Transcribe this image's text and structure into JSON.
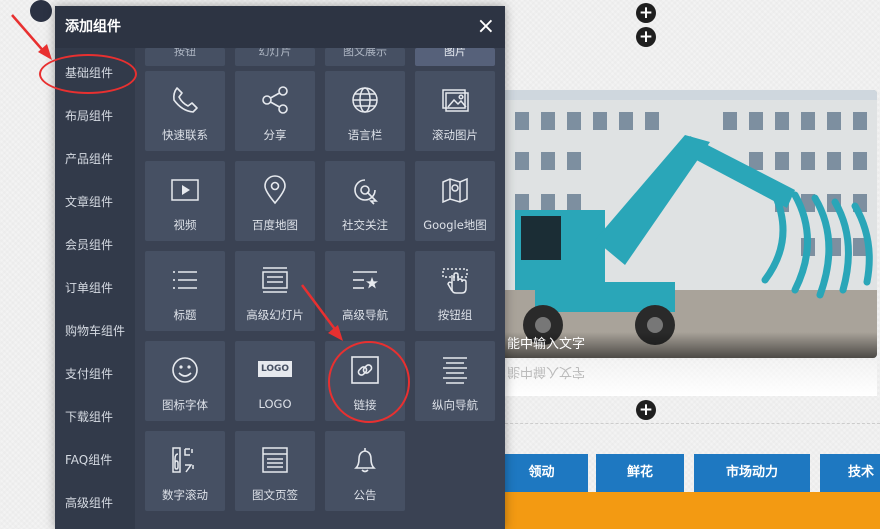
{
  "background": {
    "banner_caption": "能中输入文字",
    "reflection_text": "能中输入文字",
    "nav": [
      "领动",
      "鲜花",
      "市场动力",
      "技术"
    ]
  },
  "modal": {
    "title": "添加组件",
    "close": "×"
  },
  "sidebar": {
    "items": [
      {
        "label": "基础组件",
        "active": true
      },
      {
        "label": "布局组件"
      },
      {
        "label": "产品组件"
      },
      {
        "label": "文章组件"
      },
      {
        "label": "会员组件"
      },
      {
        "label": "订单组件"
      },
      {
        "label": "购物车组件"
      },
      {
        "label": "支付组件"
      },
      {
        "label": "下载组件"
      },
      {
        "label": "FAQ组件"
      },
      {
        "label": "高级组件"
      }
    ]
  },
  "top_row": [
    "按钮",
    "幻灯片",
    "图文展示",
    "图片"
  ],
  "tiles": [
    {
      "label": "快速联系",
      "icon": "phone-icon"
    },
    {
      "label": "分享",
      "icon": "share-icon"
    },
    {
      "label": "语言栏",
      "icon": "globe-icon"
    },
    {
      "label": "滚动图片",
      "icon": "scroll-image-icon"
    },
    {
      "label": "视频",
      "icon": "video-icon"
    },
    {
      "label": "百度地图",
      "icon": "map-pin-icon"
    },
    {
      "label": "社交关注",
      "icon": "social-follow-icon"
    },
    {
      "label": "Google地图",
      "icon": "google-map-icon"
    },
    {
      "label": "标题",
      "icon": "heading-icon"
    },
    {
      "label": "高级幻灯片",
      "icon": "advanced-slider-icon"
    },
    {
      "label": "高级导航",
      "icon": "advanced-nav-icon"
    },
    {
      "label": "按钮组",
      "icon": "button-group-icon"
    },
    {
      "label": "图标字体",
      "icon": "smiley-icon"
    },
    {
      "label": "LOGO",
      "icon": "logo-icon"
    },
    {
      "label": "链接",
      "icon": "link-icon"
    },
    {
      "label": "纵向导航",
      "icon": "vertical-nav-icon"
    },
    {
      "label": "数字滚动",
      "icon": "number-scroll-icon"
    },
    {
      "label": "图文页签",
      "icon": "image-text-tab-icon"
    },
    {
      "label": "公告",
      "icon": "bell-icon"
    }
  ],
  "logo_glyph_text": "LOGO",
  "colors": {
    "modal_bg": "#3a4253",
    "tile_bg": "#465063",
    "annotation_red": "#e83030",
    "nav_blue": "#1e78c1",
    "accent_orange": "#f39a12"
  }
}
